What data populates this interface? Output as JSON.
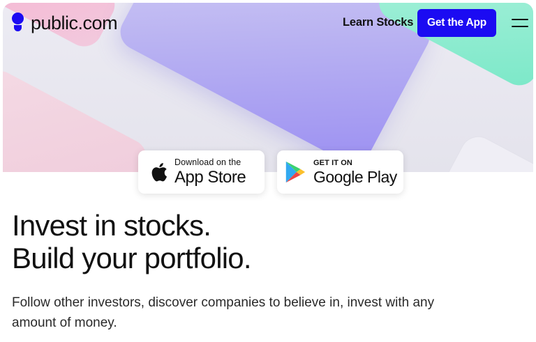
{
  "brand": {
    "name": "public.com",
    "accent_color": "#1b0bf2",
    "logo_icon": "public-logo-icon"
  },
  "nav": {
    "learn_link": "Learn Stocks",
    "cta_label": "Get the App",
    "menu_icon": "hamburger-menu-icon"
  },
  "hero": {
    "decor_colors": {
      "purple": "#b7b0f2",
      "green": "#7be8c8",
      "pink": "#f7a7c9"
    }
  },
  "badges": {
    "apple": {
      "icon": "apple-icon",
      "small": "Download on the",
      "big": "App Store"
    },
    "google": {
      "icon": "google-play-icon",
      "small": "GET IT ON",
      "big": "Google Play"
    }
  },
  "main": {
    "headline_line1": "Invest in stocks.",
    "headline_line2": "Build your portfolio.",
    "subtext": "Follow other investors, discover companies to believe in, invest with any amount of money."
  }
}
